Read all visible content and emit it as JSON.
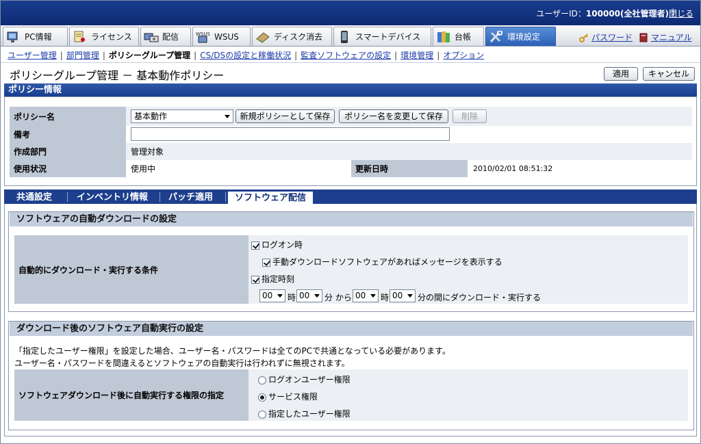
{
  "header": {
    "user_label": "ユーザーID：",
    "user_value": "100000(全社管理者)",
    "close_label": "閉じる"
  },
  "menu": {
    "tabs": [
      {
        "label": "PC情報",
        "icon": "pc-icon"
      },
      {
        "label": "ライセンス",
        "icon": "license-icon"
      },
      {
        "label": "配信",
        "icon": "distribution-icon"
      },
      {
        "label": "WSUS",
        "icon": "wsus-icon"
      },
      {
        "label": "ディスク消去",
        "icon": "disk-erase-icon"
      },
      {
        "label": "スマートデバイス",
        "icon": "smart-device-icon"
      },
      {
        "label": "台帳",
        "icon": "ledger-icon"
      },
      {
        "label": "環境設定",
        "icon": "settings-tools-icon"
      }
    ],
    "active_tab": "環境設定",
    "password_label": "パスワード",
    "manual_label": "マニュアル"
  },
  "subnav": {
    "items": [
      "ユーザー管理",
      "部門管理",
      "ポリシーグループ管理",
      "CS/DSの設定と稼働状況",
      "監査ソフトウェアの設定",
      "環境管理",
      "オプション"
    ],
    "current": "ポリシーグループ管理"
  },
  "page": {
    "title": "ポリシーグループ管理 － 基本動作ポリシー",
    "apply_label": "適用",
    "cancel_label": "キャンセル"
  },
  "policy_info": {
    "section_title": "ポリシー情報",
    "policy_name_label": "ポリシー名",
    "policy_name_value": "基本動作",
    "save_new_label": "新規ポリシーとして保存",
    "rename_save_label": "ポリシー名を変更して保存",
    "delete_label": "削除",
    "note_label": "備考",
    "note_value": "",
    "dept_label": "作成部門",
    "dept_value": "管理対象",
    "usage_label": "使用状況",
    "usage_value": "使用中",
    "updated_label": "更新日時",
    "updated_value": "2010/02/01 08:51:32"
  },
  "tabs": {
    "items": [
      "共通設定",
      "インベントリ情報",
      "パッチ適用",
      "ソフトウェア配信"
    ],
    "active": "ソフトウェア配信"
  },
  "auto_download": {
    "heading": "ソフトウェアの自動ダウンロードの設定",
    "condition_label": "自動的にダウンロード・実行する条件",
    "logon_label": "ログオン時",
    "logon_checked": true,
    "manual_msg_label": "手動ダウンロードソフトウェアがあればメッセージを表示する",
    "manual_msg_checked": true,
    "scheduled_label": "指定時刻",
    "scheduled_checked": true,
    "from_hour": "00",
    "hour_unit": "時",
    "from_min": "00",
    "from_text": "分 から",
    "to_hour": "00",
    "to_min": "00",
    "to_text": "分の間にダウンロード・実行する"
  },
  "auto_exec": {
    "heading": "ダウンロード後のソフトウェア自動実行の設定",
    "note_line1": "「指定したユーザー権限」を設定した場合、ユーザー名・パスワードは全てのPCで共通となっている必要があります。",
    "note_line2": "ユーザー名・パスワードを間違えるとソフトウェアの自動実行は行われずに無視されます。",
    "privilege_label": "ソフトウェアダウンロード後に自動実行する権限の指定",
    "options": [
      "ログオンユーザー権限",
      "サービス権限",
      "指定したユーザー権限"
    ],
    "selected": "サービス権限"
  }
}
